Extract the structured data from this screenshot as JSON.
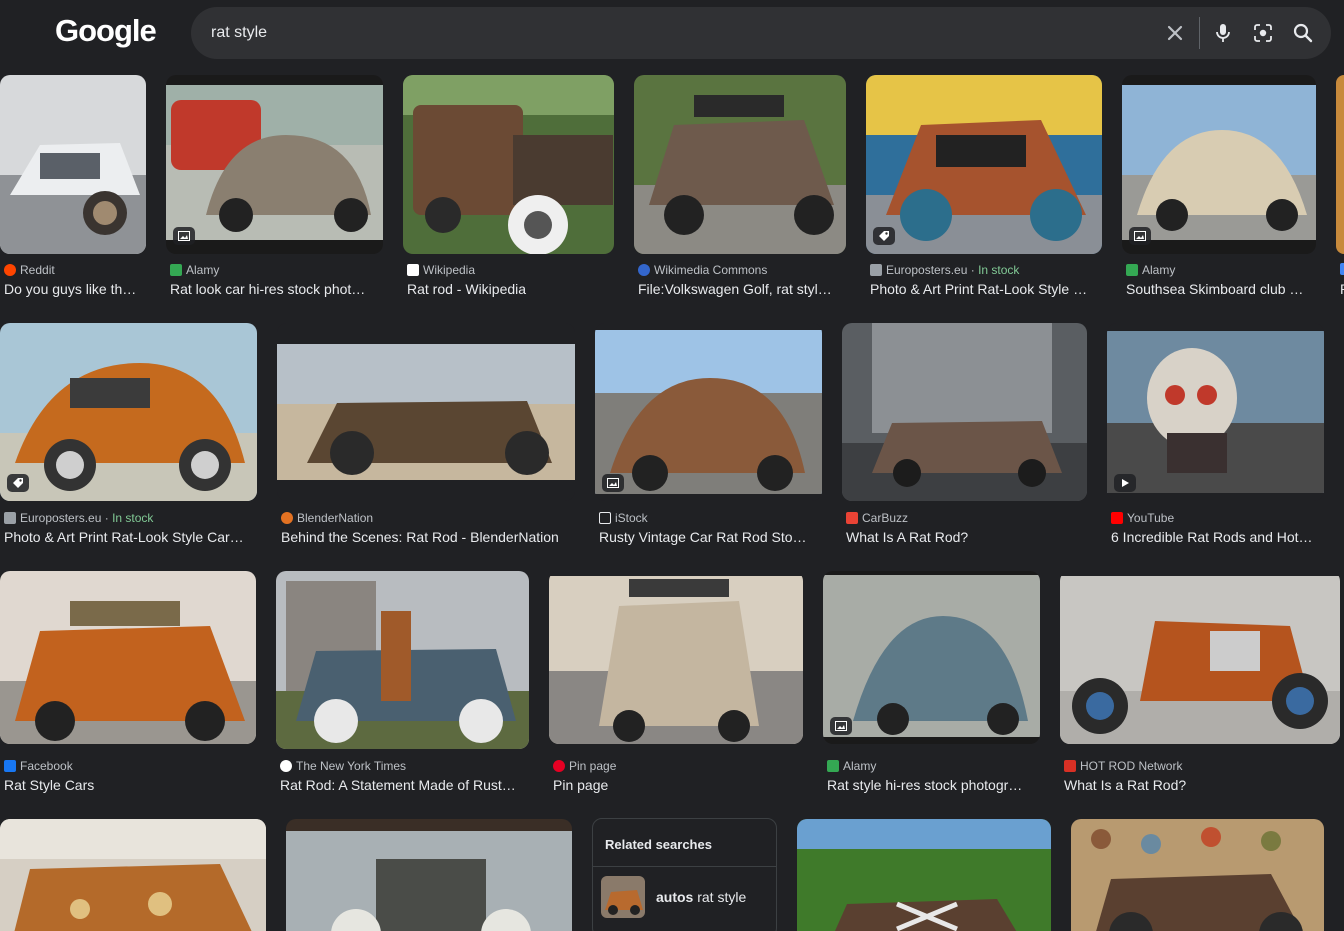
{
  "header": {
    "logo": "Google",
    "query": "rat style"
  },
  "results": [
    {
      "source": "Reddit",
      "title": "Do you guys like th…",
      "favicon_color": "#ff4500"
    },
    {
      "source": "Alamy",
      "title": "Rat look car hi-res stock phot…",
      "favicon_color": "#34a853"
    },
    {
      "source": "Wikipedia",
      "title": "Rat rod - Wikipedia",
      "favicon_color": "#ffffff"
    },
    {
      "source": "Wikimedia Commons",
      "title": "File:Volkswagen Golf, rat styl…",
      "favicon_color": "#3366cc"
    },
    {
      "source": "Europosters.eu",
      "stock": "In stock",
      "title": "Photo & Art Print Rat-Look Style …",
      "favicon_color": "#9aa0a6"
    },
    {
      "source": "Alamy",
      "title": "Southsea Skimboard club …",
      "favicon_color": "#34a853"
    },
    {
      "source": "",
      "title": "R",
      "favicon_color": "#4285f4"
    },
    {
      "source": "Europosters.eu",
      "stock": "In stock",
      "title": "Photo & Art Print Rat-Look Style Car…",
      "favicon_color": "#9aa0a6"
    },
    {
      "source": "BlenderNation",
      "title": "Behind the Scenes: Rat Rod - BlenderNation",
      "favicon_color": "#e37222"
    },
    {
      "source": "iStock",
      "title": "Rusty Vintage Car Rat Rod Sto…",
      "favicon_color": "#202124"
    },
    {
      "source": "CarBuzz",
      "title": "What Is A Rat Rod?",
      "favicon_color": "#ea4335"
    },
    {
      "source": "YouTube",
      "title": "6 Incredible Rat Rods and Hot…",
      "favicon_color": "#ff0000"
    },
    {
      "source": "Facebook",
      "title": "Rat Style Cars",
      "favicon_color": "#1877f2"
    },
    {
      "source": "The New York Times",
      "title": "Rat Rod: A Statement Made of Rust…",
      "favicon_color": "#ffffff"
    },
    {
      "source": "Pin page",
      "title": "Pin page",
      "favicon_color": "#e60023"
    },
    {
      "source": "Alamy",
      "title": "Rat style hi-res stock photogr…",
      "favicon_color": "#34a853"
    },
    {
      "source": "HOT ROD Network",
      "title": "What Is a Rat Rod?",
      "favicon_color": "#d93025"
    }
  ],
  "related": {
    "heading": "Related searches",
    "items": [
      {
        "bold": "autos",
        "rest": " rat style"
      }
    ]
  }
}
